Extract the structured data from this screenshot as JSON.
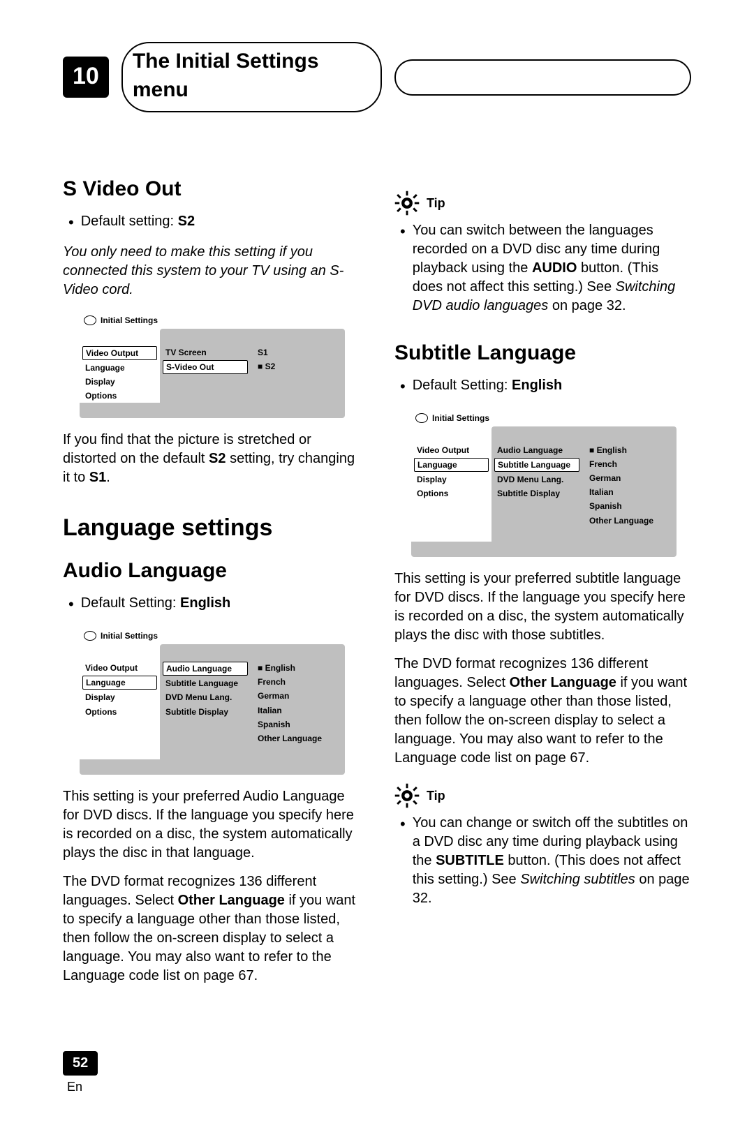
{
  "header": {
    "chapter_number": "10",
    "chapter_title": "The Initial Settings menu"
  },
  "left_col": {
    "svideo": {
      "heading": "S Video Out",
      "default_label": "Default setting: ",
      "default_value": "S2",
      "note_italic": "You only need to make this setting if you connected this system to your TV using an S-Video cord.",
      "after_text_1": "If you find that the picture is stretched or distorted on the default ",
      "after_bold_1": "S2",
      "after_text_2": " setting, try changing it to ",
      "after_bold_2": "S1",
      "after_text_3": "."
    },
    "svideo_menu": {
      "title": "Initial Settings",
      "left_items": [
        "Video Output",
        "Language",
        "Display",
        "Options"
      ],
      "left_selected": 0,
      "mid_items": [
        "TV Screen",
        "S-Video Out"
      ],
      "mid_selected": 1,
      "right_items": [
        "S1",
        "S2"
      ],
      "right_selected": 1
    },
    "lang_section_heading": "Language settings",
    "audio_lang": {
      "heading": "Audio Language",
      "default_label": "Default Setting: ",
      "default_value": "English"
    },
    "audio_menu": {
      "title": "Initial Settings",
      "left_items": [
        "Video Output",
        "Language",
        "Display",
        "Options"
      ],
      "left_selected": 1,
      "mid_items": [
        "Audio Language",
        "Subtitle Language",
        "DVD Menu Lang.",
        "Subtitle Display"
      ],
      "mid_selected": 0,
      "right_items": [
        "English",
        "French",
        "German",
        "Italian",
        "Spanish",
        "Other Language"
      ],
      "right_selected": 0
    },
    "audio_para1": "This setting is your preferred Audio Language for DVD discs. If the language you specify here is recorded on a disc, the system automatically plays the disc in that language.",
    "audio_para2_a": "The DVD format recognizes 136 different languages. Select ",
    "audio_para2_bold": "Other Language",
    "audio_para2_b": " if you want to specify a language other than those listed, then follow the on-screen display to select a language. You may also want to refer to the Language code list on page 67."
  },
  "right_col": {
    "tip1_label": "Tip",
    "tip1_text_a": "You can switch between the languages recorded on a DVD disc any time during playback using the ",
    "tip1_bold": "AUDIO",
    "tip1_text_b": " button. (This does not affect this setting.) See ",
    "tip1_italic": "Switching DVD audio languages",
    "tip1_text_c": " on page 32.",
    "subtitle": {
      "heading": "Subtitle Language",
      "default_label": "Default Setting: ",
      "default_value": "English"
    },
    "subtitle_menu": {
      "title": "Initial Settings",
      "left_items": [
        "Video Output",
        "Language",
        "Display",
        "Options"
      ],
      "left_selected": 1,
      "mid_items": [
        "Audio Language",
        "Subtitle Language",
        "DVD Menu Lang.",
        "Subtitle Display"
      ],
      "mid_selected": 1,
      "right_items": [
        "English",
        "French",
        "German",
        "Italian",
        "Spanish",
        "Other Language"
      ],
      "right_selected": 0
    },
    "sub_para1": "This setting is your preferred subtitle language for DVD discs. If the language you specify here is recorded on a disc, the system automatically plays the disc with those subtitles.",
    "sub_para2_a": "The DVD format recognizes 136 different languages. Select ",
    "sub_para2_bold": "Other Language",
    "sub_para2_b": " if you want to specify a language other than those listed, then follow the on-screen display to select a language. You may also want to refer to the Language code list on page 67.",
    "tip2_label": "Tip",
    "tip2_text_a": "You can change or switch off the subtitles on a DVD disc any time during playback using the ",
    "tip2_bold": "SUBTITLE",
    "tip2_text_b": " button. (This does not affect this setting.) See ",
    "tip2_italic": "Switching subtitles",
    "tip2_text_c": " on page 32."
  },
  "footer": {
    "page_number": "52",
    "lang_code": "En"
  }
}
